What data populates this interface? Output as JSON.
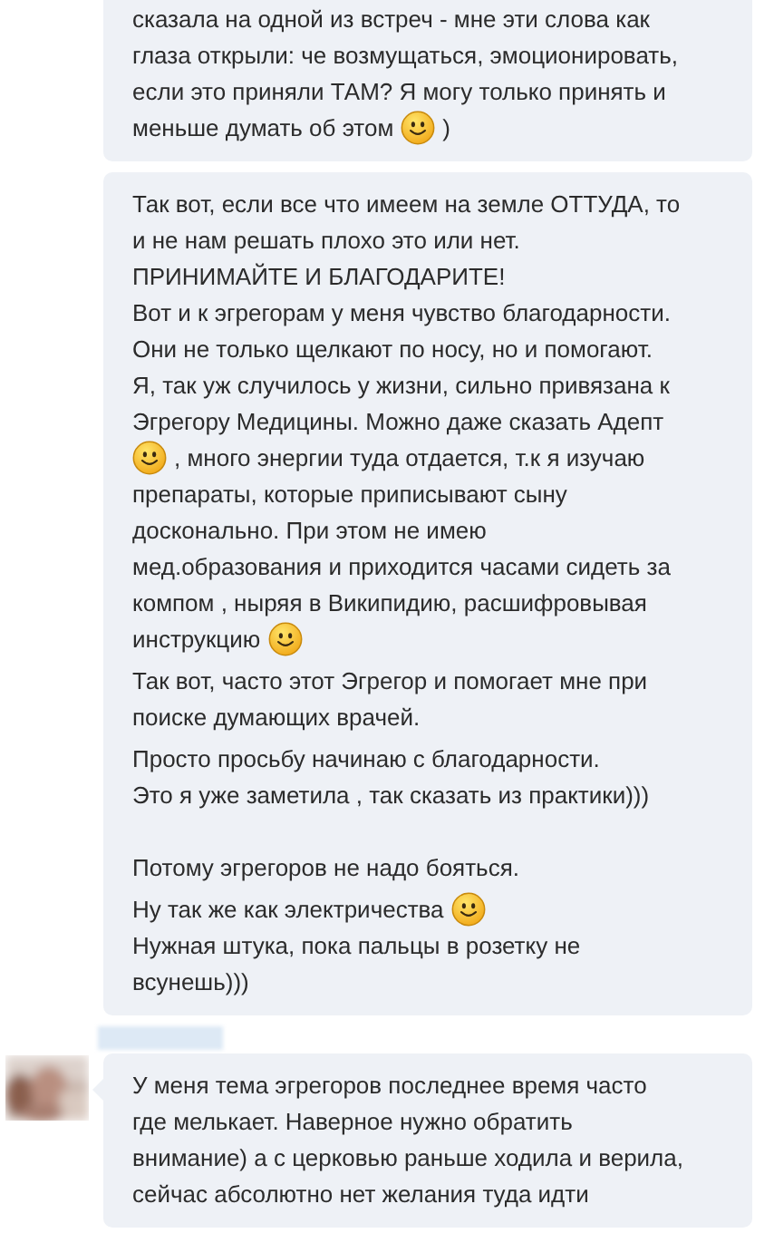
{
  "messages": [
    {
      "blocks": [
        {
          "spaced": false,
          "lines": [
            [
              {
                "kind": "text",
                "text": "сказала на одной из встреч - мне эти слова как"
              }
            ],
            [
              {
                "kind": "text",
                "text": "глаза открыли: че возмущаться, эмоционировать,"
              }
            ],
            [
              {
                "kind": "text",
                "text": "если это приняли ТАМ? Я могу только принять и"
              }
            ],
            [
              {
                "kind": "text",
                "text": "меньше думать об этом"
              },
              {
                "kind": "emoji"
              },
              {
                "kind": "text",
                "text": ")"
              }
            ]
          ]
        }
      ]
    },
    {
      "blocks": [
        {
          "spaced": false,
          "lines": [
            [
              {
                "kind": "text",
                "text": "Так вот, если все что имеем на земле ОТТУДА, то"
              }
            ],
            [
              {
                "kind": "text",
                "text": "и не нам решать плохо это или нет."
              }
            ],
            [
              {
                "kind": "text",
                "text": "ПРИНИМАЙТЕ И БЛАГОДАРИТЕ!"
              }
            ],
            [
              {
                "kind": "text",
                "text": "Вот и к эгрегорам у меня чувство благодарности."
              }
            ],
            [
              {
                "kind": "text",
                "text": "Они не только щелкают по носу, но и помогают."
              }
            ],
            [
              {
                "kind": "text",
                "text": "Я, так уж случилось у жизни, сильно привязана к"
              }
            ],
            [
              {
                "kind": "text",
                "text": "Эгрегору Медицины. Можно даже сказать Адепт"
              }
            ],
            [
              {
                "kind": "emoji"
              },
              {
                "kind": "text",
                "text": ", много энергии туда отдается, т.к я изучаю"
              }
            ],
            [
              {
                "kind": "text",
                "text": "препараты, которые приписывают сыну"
              }
            ],
            [
              {
                "kind": "text",
                "text": "досконально. При этом не имею"
              }
            ],
            [
              {
                "kind": "text",
                "text": "мед.образования и приходится часами сидеть за"
              }
            ],
            [
              {
                "kind": "text",
                "text": "компом , ныряя в Википидию, расшифровывая"
              }
            ],
            [
              {
                "kind": "text",
                "text": "инструкцию"
              },
              {
                "kind": "emoji"
              }
            ]
          ]
        },
        {
          "spaced": false,
          "lines": [
            [
              {
                "kind": "text",
                "text": "Так вот, часто этот Эгрегор и помогает мне при"
              }
            ],
            [
              {
                "kind": "text",
                "text": "поиске думающих врачей."
              }
            ]
          ]
        },
        {
          "spaced": false,
          "lines": [
            [
              {
                "kind": "text",
                "text": "Просто просьбу начинаю с благодарности."
              }
            ],
            [
              {
                "kind": "text",
                "text": "Это я уже заметила , так сказать из практики)))"
              }
            ]
          ]
        },
        {
          "spaced": true,
          "lines": [
            [
              {
                "kind": "text",
                "text": "Потому эгрегоров не надо бояться."
              }
            ]
          ]
        },
        {
          "spaced": false,
          "lines": [
            [
              {
                "kind": "text",
                "text": "Ну так же как электричества"
              },
              {
                "kind": "emoji"
              }
            ],
            [
              {
                "kind": "text",
                "text": "Нужная штука, пока пальцы в розетку не"
              }
            ],
            [
              {
                "kind": "text",
                "text": "всунешь)))"
              }
            ]
          ]
        }
      ]
    },
    {
      "sender": {
        "avatar": {
          "kind": "picture"
        }
      },
      "blocks": [
        {
          "spaced": false,
          "lines": [
            [
              {
                "kind": "text",
                "text": "У меня тема эгрегоров последнее время часто"
              }
            ],
            [
              {
                "kind": "text",
                "text": "где мелькает. Наверное нужно обратить"
              }
            ],
            [
              {
                "kind": "text",
                "text": "внимание) а с церковью раньше ходила и верила,"
              }
            ],
            [
              {
                "kind": "text",
                "text": "сейчас абсолютно нет желания туда идти"
              }
            ]
          ]
        }
      ]
    }
  ]
}
